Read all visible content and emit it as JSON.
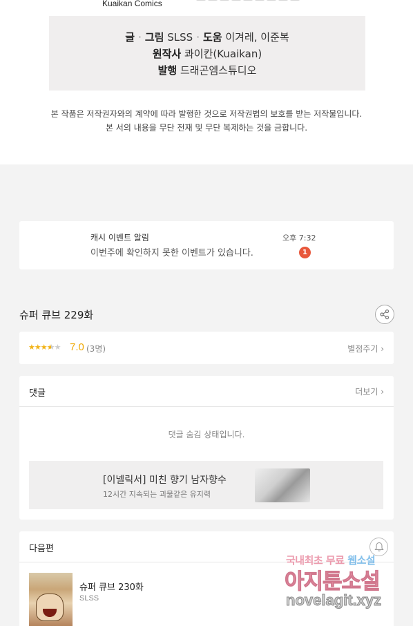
{
  "header": {
    "publisher": "Kuaikan Comics"
  },
  "credits": {
    "line1_label_a": "글",
    "line1_label_b": "그림",
    "line1_value_ab": "SLSS",
    "line1_label_c": "도움",
    "line1_value_c": "이겨레, 이준복",
    "line2_label": "원작사",
    "line2_value": "콰이칸(Kuaikan)",
    "line3_label": "발행",
    "line3_value": "드래곤엠스튜디오",
    "separator": "·"
  },
  "copyright_notice": {
    "line1": "본 작품은 저작권자와의 계약에 따라 발행한 것으로 저작권법의 보호를 받는 저작물입니다.",
    "line2": "본 서의 내용을 무단 전재 및 무단 복제하는 것을 금합니다."
  },
  "event_alert": {
    "title": "캐시 이벤트 알림",
    "message": "이번주에 확인하지 못한 이벤트가 있습니다.",
    "time": "오후 7:32",
    "badge_count": "1"
  },
  "episode": {
    "title": "슈퍼 큐브 229화",
    "share_icon": "share-icon"
  },
  "rating": {
    "stars_filled": 3.5,
    "stars_max": 5,
    "score": "7.0",
    "count": "(3명)",
    "rate_label": "별점주기 ›"
  },
  "comments": {
    "header": "댓글",
    "more_label": "더보기 ›",
    "hidden_message": "댓글 숨김 상태입니다.",
    "ad": {
      "title": "[이넬릭서] 미친 향기 남자향수",
      "subtitle": "12시간 지속되는 괴물같은 유지력"
    }
  },
  "next_episode": {
    "header": "다음편",
    "bell_icon": "bell-icon",
    "title": "슈퍼 큐브 230화",
    "author": "SLSS"
  },
  "watermark": {
    "line1_a": "국내최초 무료",
    "line1_b": "웹소설",
    "line2": "아지툰소설",
    "line3": "novelagit.xyz"
  },
  "colors": {
    "accent_orange": "#f0a800",
    "badge_red": "#e8573b",
    "page_bg": "#f3f3f3"
  }
}
